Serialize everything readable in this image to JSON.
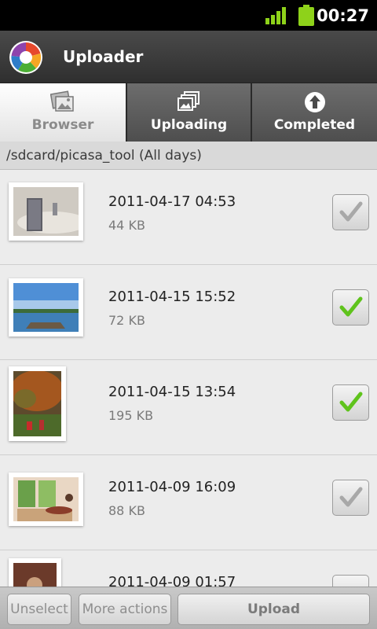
{
  "status_bar": {
    "time": "00:27",
    "signal_icon": "signal-bars-icon",
    "battery_icon": "battery-icon",
    "accent": "#8ed21a"
  },
  "app": {
    "title": "Uploader",
    "logo_icon": "picasa-logo-icon"
  },
  "tabs": [
    {
      "label": "Browser",
      "icon": "photos-icon",
      "selected": true
    },
    {
      "label": "Uploading",
      "icon": "stacked-photos-icon",
      "selected": false
    },
    {
      "label": "Completed",
      "icon": "upload-arrow-icon",
      "selected": false
    }
  ],
  "path": "/sdcard/picasa_tool (All days)",
  "files": [
    {
      "date": "2011-04-17 04:53",
      "size": "44 KB",
      "checked": false
    },
    {
      "date": "2011-04-15 15:52",
      "size": "72 KB",
      "checked": true
    },
    {
      "date": "2011-04-15 13:54",
      "size": "195 KB",
      "checked": true
    },
    {
      "date": "2011-04-09 16:09",
      "size": "88 KB",
      "checked": false
    },
    {
      "date": "2011-04-09 01:57",
      "size": "",
      "checked": false
    }
  ],
  "bottom_bar": {
    "unselect": "Unselect",
    "more_actions": "More actions",
    "upload": "Upload"
  },
  "colors": {
    "check_green": "#5fc31c",
    "check_gray": "#a8a8a8"
  }
}
